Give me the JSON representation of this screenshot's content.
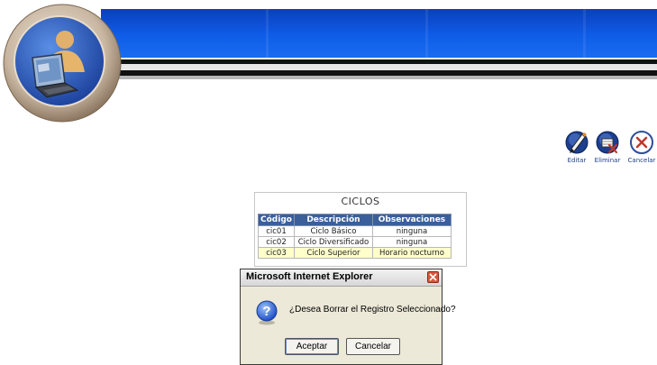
{
  "toolbar": {
    "edit_label": "Editar",
    "delete_label": "Eliminar",
    "cancel_label": "Cancelar"
  },
  "table": {
    "title": "CICLOS",
    "headers": [
      "Código",
      "Descripción",
      "Observaciones"
    ],
    "rows": [
      [
        "cic01",
        "Ciclo Básico",
        "ninguna"
      ],
      [
        "cic02",
        "Ciclo Diversificado",
        "ninguna"
      ],
      [
        "cic03",
        "Ciclo Superior",
        "Horario nocturno"
      ]
    ],
    "selected_row": 2
  },
  "dialog": {
    "title": "Microsoft Internet Explorer",
    "message": "¿Desea Borrar el Registro Seleccionado?",
    "ok_label": "Aceptar",
    "cancel_label": "Cancelar"
  },
  "colors": {
    "banner_blue": "#0f5de8",
    "table_header": "#3a5f9b",
    "selected_row": "#ffffcc",
    "dialog_bg": "#ece9d8"
  }
}
